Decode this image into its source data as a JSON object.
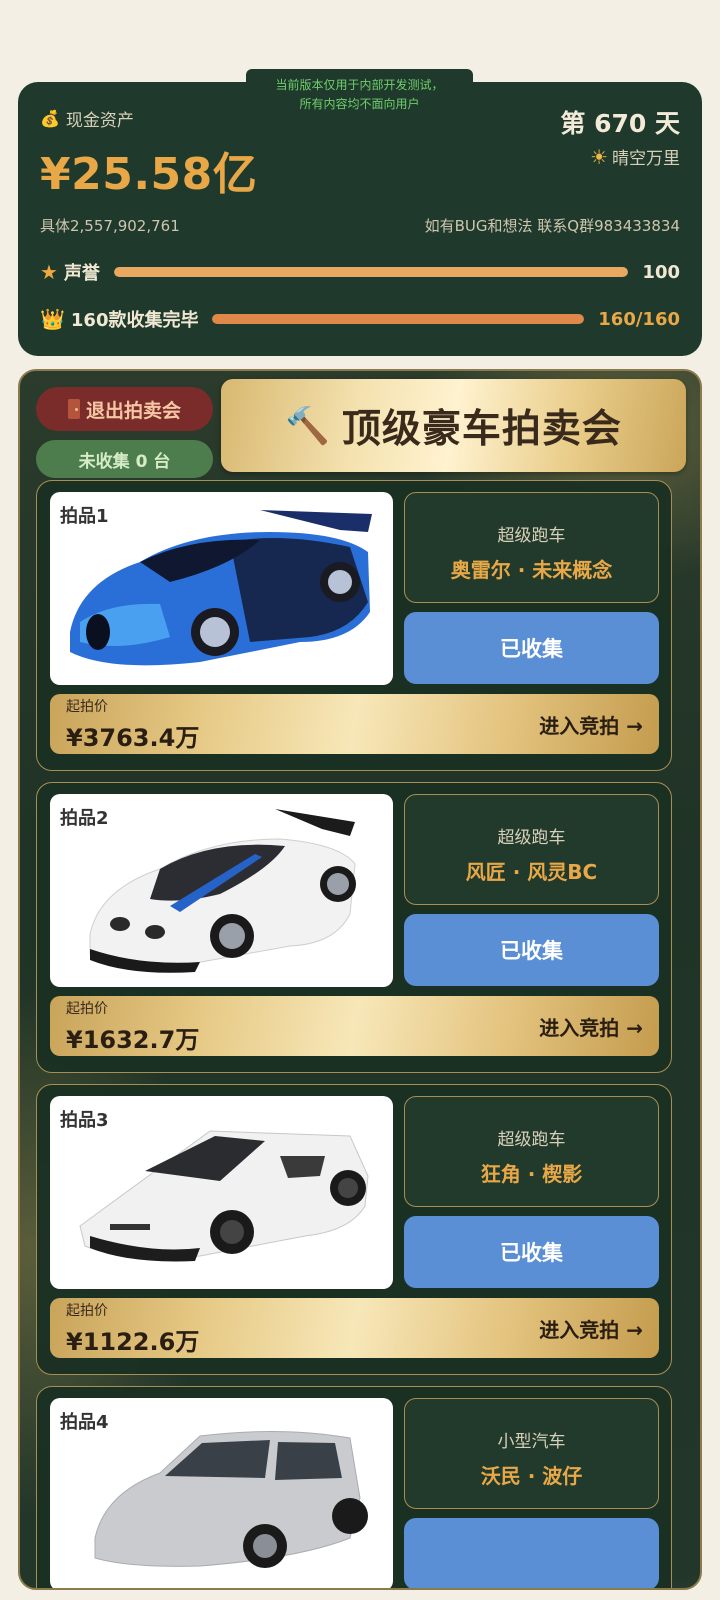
{
  "notice": {
    "line1": "当前版本仅用于内部开发测试，",
    "line2": "所有内容均不面向用户"
  },
  "status": {
    "cash_label": "现金资产",
    "cash_value": "¥25.58亿",
    "exact_value": "具体2,557,902,761",
    "day": "第 670 天",
    "weather": "晴空万里",
    "contact": "如有BUG和想法 联系Q群983433834",
    "reputation_label": "声誉",
    "reputation_value": "100",
    "reputation_fraction": 1.0,
    "collection_label": "160款收集完毕",
    "collection_value": "160/160",
    "collection_fraction": 1.0
  },
  "auction": {
    "exit_label": "退出拍卖会",
    "uncollected_label": "未收集 0 台",
    "title": "顶级豪车拍卖会",
    "lots": [
      {
        "lot_no": "拍品1",
        "car_class": "超级跑车",
        "car_name": "奥雷尔 · 未来概念",
        "status": "已收集",
        "price_label": "起拍价",
        "price": "¥3763.4万",
        "bid_label": "进入竞拍 →"
      },
      {
        "lot_no": "拍品2",
        "car_class": "超级跑车",
        "car_name": "风匠 · 风灵BC",
        "status": "已收集",
        "price_label": "起拍价",
        "price": "¥1632.7万",
        "bid_label": "进入竞拍 →"
      },
      {
        "lot_no": "拍品3",
        "car_class": "超级跑车",
        "car_name": "狂角 · 楔影",
        "status": "已收集",
        "price_label": "起拍价",
        "price": "¥1122.6万",
        "bid_label": "进入竞拍 →"
      },
      {
        "lot_no": "拍品4",
        "car_class": "小型汽车",
        "car_name": "沃民 · 波仔",
        "status": "",
        "price_label": "",
        "price": "",
        "bid_label": ""
      }
    ]
  },
  "colors": {
    "panel_green": "#1f3a2c",
    "accent_gold": "#e8a848",
    "collected_blue": "#5a8fd6",
    "exit_red": "#7a2c2a"
  }
}
